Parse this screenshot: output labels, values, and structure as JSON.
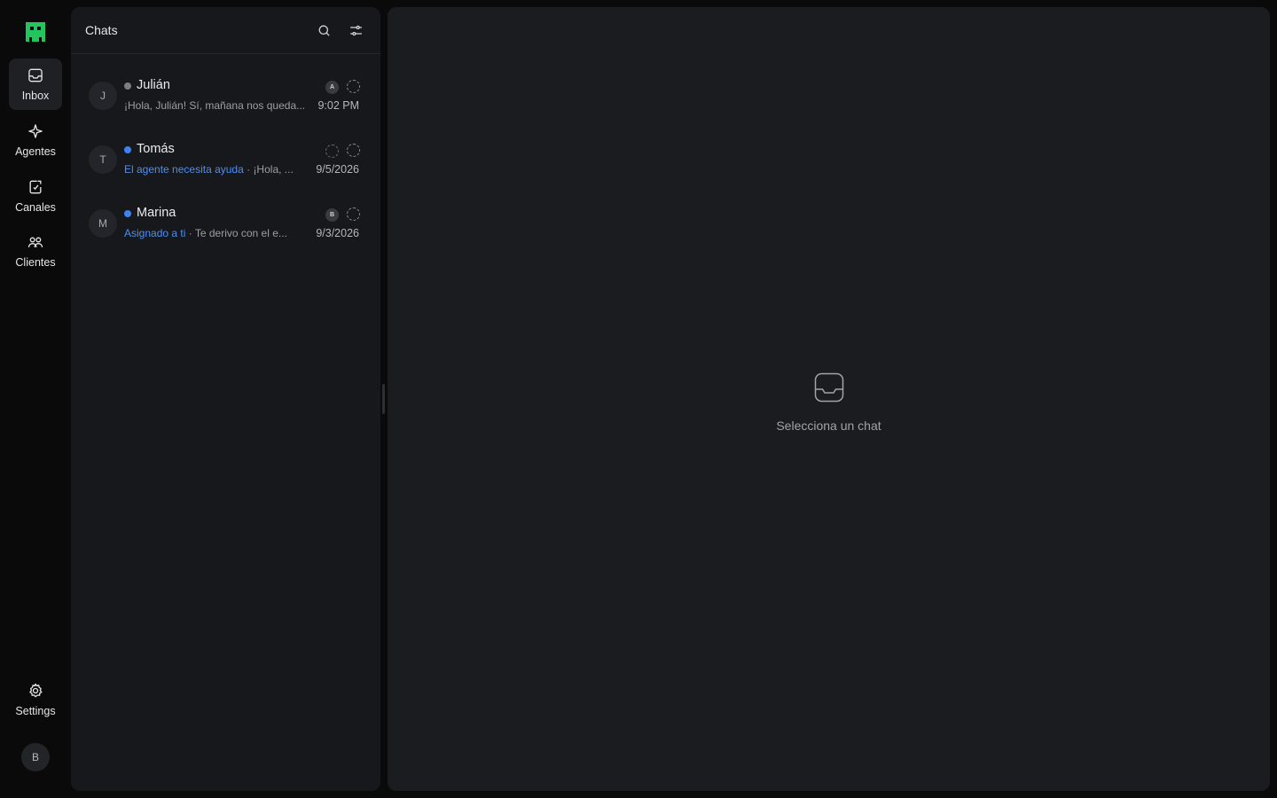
{
  "colors": {
    "brand": "#22c55e",
    "accent": "#4d8ef2",
    "status_offline": "#7c7d82",
    "status_online": "#3b82f6"
  },
  "nav": {
    "items": [
      {
        "label": "Inbox",
        "icon": "inbox-icon",
        "active": true
      },
      {
        "label": "Agentes",
        "icon": "sparkle-icon"
      },
      {
        "label": "Canales",
        "icon": "channel-icon"
      },
      {
        "label": "Clientes",
        "icon": "users-icon"
      }
    ],
    "settings_label": "Settings",
    "user_initial": "B"
  },
  "chats": {
    "title": "Chats",
    "items": [
      {
        "initial": "J",
        "name": "Julián",
        "tag": "",
        "preview": "¡Hola, Julián! Sí, mañana nos queda...",
        "time": "9:02 PM",
        "badge": "A",
        "status": "offline"
      },
      {
        "initial": "T",
        "name": "Tomás",
        "tag": "El agente necesita ayuda",
        "preview": "· ¡Hola, ...",
        "time": "9/5/2026",
        "badge": "",
        "status": "online"
      },
      {
        "initial": "M",
        "name": "Marina",
        "tag": "Asignado a ti",
        "preview": "· Te derivo con el e...",
        "time": "9/3/2026",
        "badge": "B",
        "status": "online"
      }
    ]
  },
  "main": {
    "empty_text": "Selecciona un chat"
  }
}
